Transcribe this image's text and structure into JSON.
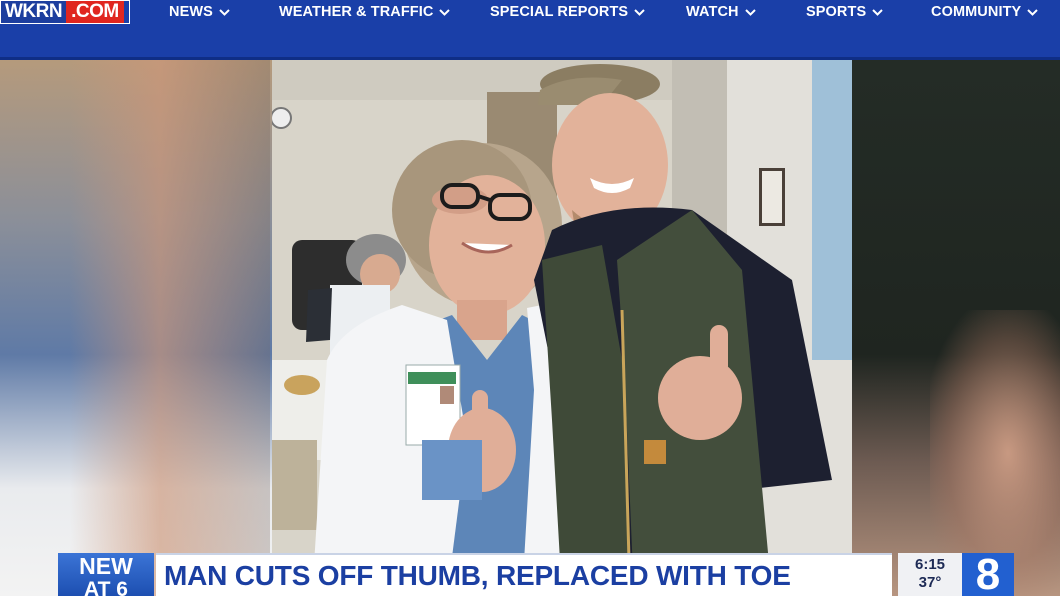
{
  "site": {
    "logo_part1": "WKRN",
    "logo_part2": ".COM",
    "colors": {
      "nav_bg": "#1a3fa8",
      "logo_red": "#e0261f",
      "headline_blue": "#1b3fa2"
    }
  },
  "nav": {
    "items": [
      {
        "label": "NEWS",
        "icon": "chevron-down-icon"
      },
      {
        "label": "WEATHER & TRAFFIC",
        "icon": "chevron-down-icon"
      },
      {
        "label": "SPECIAL REPORTS",
        "icon": "chevron-down-icon"
      },
      {
        "label": "WATCH",
        "icon": "chevron-down-icon"
      },
      {
        "label": "SPORTS",
        "icon": "chevron-down-icon"
      },
      {
        "label": "COMMUNITY",
        "icon": "chevron-down-icon"
      }
    ]
  },
  "lower_third": {
    "badge_line1": "NEW",
    "badge_line2": "AT 6",
    "headline": "MAN CUTS OFF THUMB, REPLACED WITH TOE",
    "time": "6:15",
    "temp": "37°",
    "station_logo": "8"
  }
}
